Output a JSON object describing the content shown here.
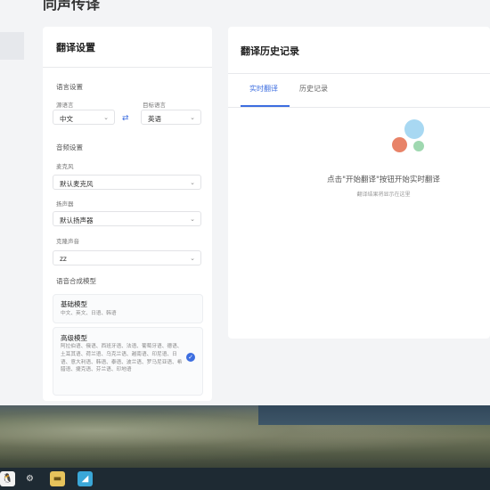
{
  "app": {
    "page_title": "同声传译",
    "settings": {
      "title": "翻译设置",
      "language_section": "语言设置",
      "source_label": "源语言",
      "source_value": "中文",
      "target_label": "目标语言",
      "target_value": "英语",
      "audio_section": "音频设置",
      "mic_label": "麦克风",
      "mic_value": "默认麦克风",
      "speaker_label": "扬声器",
      "speaker_value": "默认扬声器",
      "voice_label": "克隆声音",
      "voice_value": "zz",
      "synth_section": "语音合成模型",
      "models": [
        {
          "name": "基础模型",
          "desc": "中文、英文、日语、韩语"
        },
        {
          "name": "高级模型",
          "desc": "阿拉伯语、俄语、西班牙语、法语、葡萄牙语、德语、土耳其语、荷兰语、乌克兰语、越南语、印尼语、日语、意大利语、韩语、泰语、波兰语、罗马尼亚语、希腊语、捷克语、芬兰语、印地语"
        }
      ]
    },
    "history": {
      "title": "翻译历史记录",
      "tabs": [
        "实时翻译",
        "历史记录"
      ],
      "empty_title": "点击\"开始翻译\"按钮开始实时翻译",
      "empty_sub": "翻译结果将显示在这里"
    }
  },
  "colors": {
    "accent": "#3d6ee0",
    "dot_blue": "#a8d8f2",
    "dot_red": "#e88368",
    "dot_green": "#9fd8b0"
  },
  "taskbar": {
    "icons": [
      "penguin-icon",
      "gear-icon",
      "folder-icon",
      "app-icon"
    ]
  }
}
